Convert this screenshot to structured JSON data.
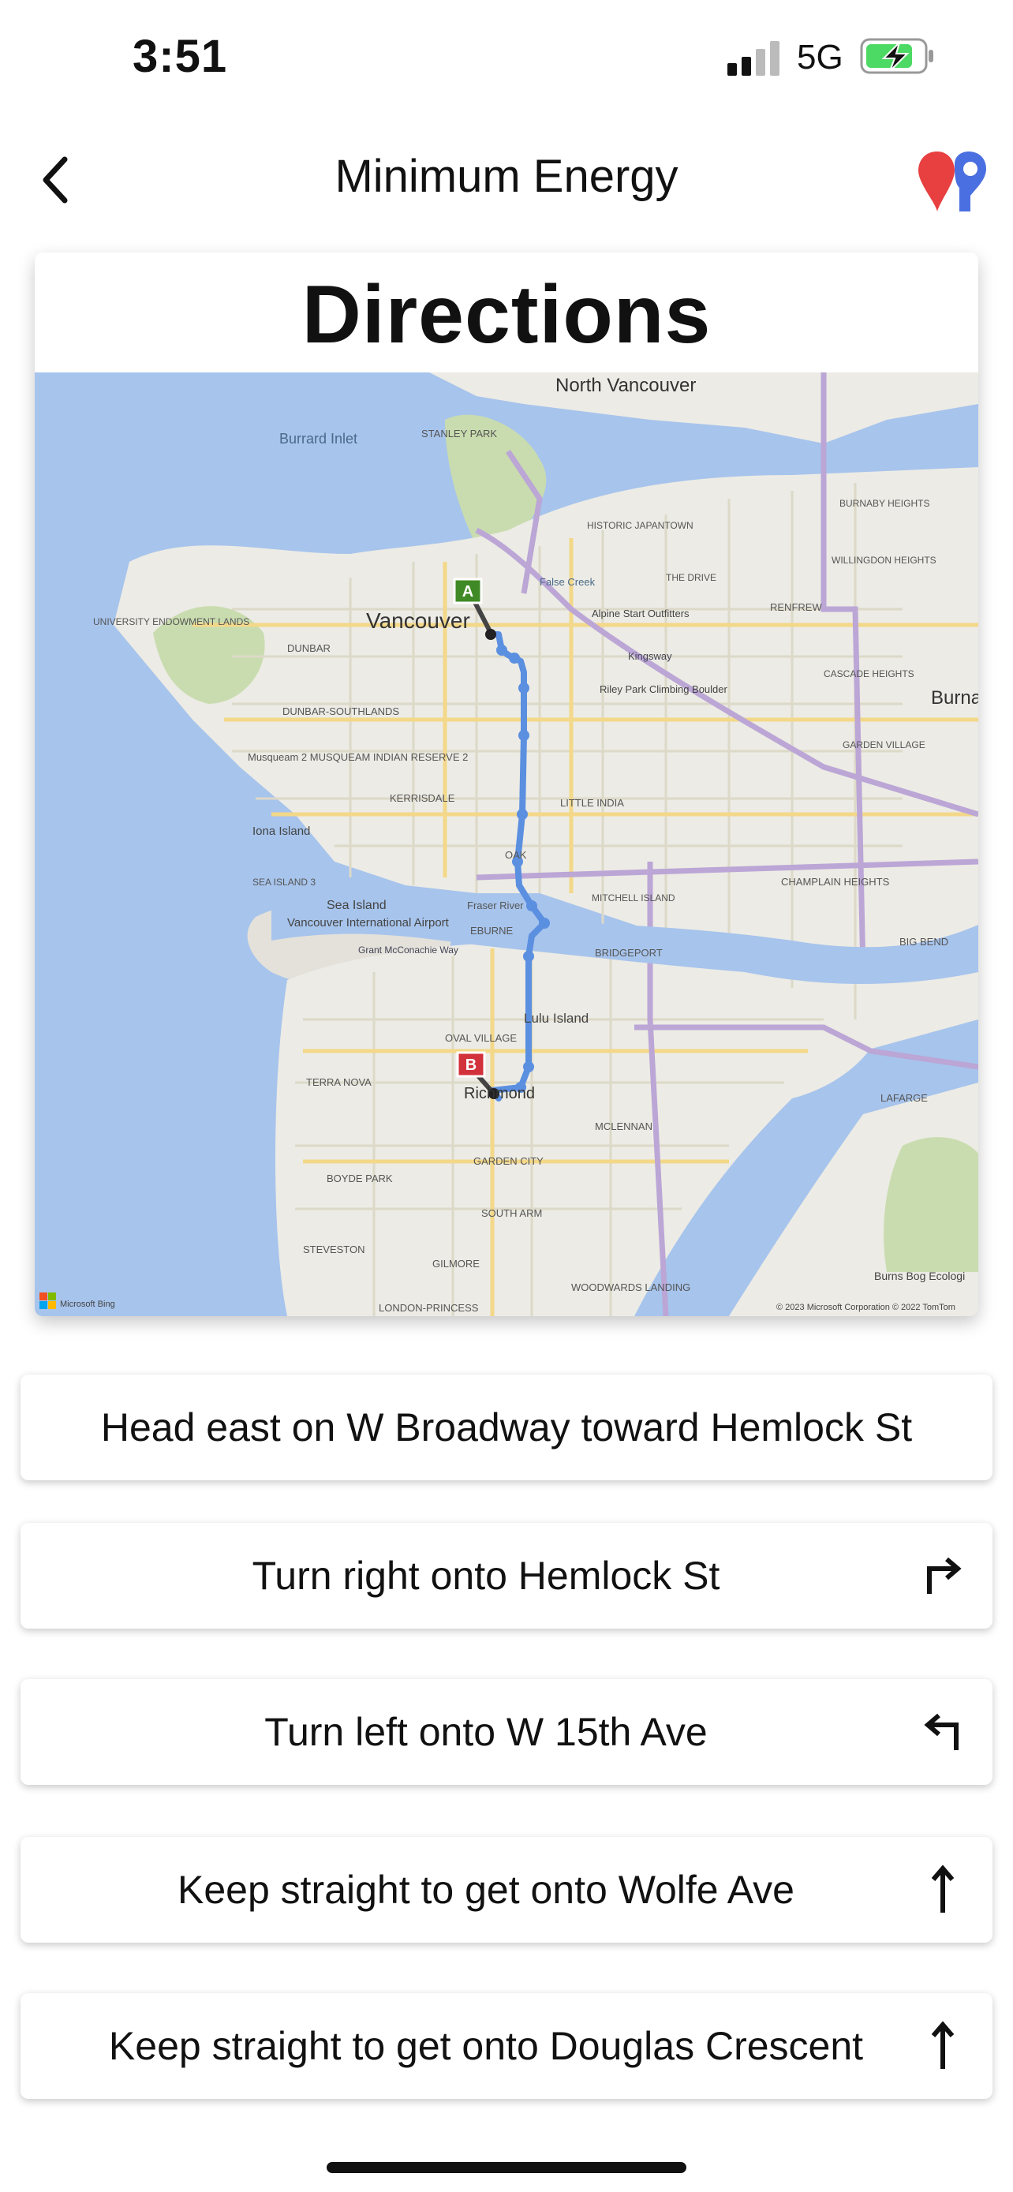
{
  "status_bar": {
    "time": "3:51",
    "network": "5G"
  },
  "nav": {
    "title": "Minimum Energy"
  },
  "card": {
    "title": "Directions"
  },
  "map": {
    "labels": {
      "north_vancouver": "North Vancouver",
      "burrard_inlet": "Burrard Inlet",
      "stanley_park": "STANLEY PARK",
      "vancouver": "Vancouver",
      "university": "UNIVERSITY ENDOWMENT LANDS",
      "dunbar": "DUNBAR",
      "dunbar_southlands": "DUNBAR-SOUTHLANDS",
      "kerrisdale": "KERRISDALE",
      "oak": "OAK",
      "musqueam": "Musqueam 2 MUSQUEAM INDIAN RESERVE 2",
      "iona": "Iona Island",
      "sea_island": "Sea Island",
      "airport": "Vancouver International Airport",
      "fraser_river": "Fraser River",
      "eburne": "EBURNE",
      "bridgeport": "BRIDGEPORT",
      "lulu": "Lulu Island",
      "richmond": "Richmond",
      "terra_nova": "TERRA NOVA",
      "oval_village": "OVAL VILLAGE",
      "mclennan": "MCLENNAN",
      "garden_city": "GARDEN CITY",
      "boyde_park": "BOYDE PARK",
      "south_arm": "SOUTH ARM",
      "steveston": "STEVESTON",
      "gilmore": "GILMORE",
      "woodwards": "WOODWARDS LANDING",
      "london_princess": "LONDON-PRINCESS",
      "burnaby": "Burna",
      "burnaby_heights": "BURNABY HEIGHTS",
      "willingdon": "WILLINGDON HEIGHTS",
      "renfrew": "RENFREW",
      "cascade": "CASCADE HEIGHTS",
      "garden_village": "GARDEN VILLAGE",
      "champlain": "CHAMPLAIN HEIGHTS",
      "big_bend": "BIG BEND",
      "lafarge": "LAFARGE",
      "burns_bog": "Burns Bog Ecologi",
      "little_india": "LITTLE INDIA",
      "mitchell": "MITCHELL ISLAND",
      "riley_park": "Riley Park Climbing Boulder",
      "historic_japantown": "HISTORIC JAPANTOWN",
      "the_drive": "THE DRIVE",
      "alpine": "Alpine Start Outfitters",
      "false_creek": "False Creek",
      "grant_mcconachie": "Grant McConachie Way",
      "kingsway": "Kingsway",
      "sea_island_3": "SEA ISLAND 3",
      "marker_a": "A",
      "marker_b": "B",
      "attribution": "© 2023 Microsoft Corporation © 2022 TomTom",
      "bing": "Microsoft Bing"
    },
    "colors": {
      "water": "#a7c4ec",
      "land": "#ecebe5",
      "route": "#5b8fe0",
      "park": "#c9dcaf",
      "major_road": "#bba6d6"
    }
  },
  "steps": [
    {
      "text": "Head east on W Broadway toward Hemlock St",
      "icon": "none"
    },
    {
      "text": "Turn right onto Hemlock St",
      "icon": "turn-right-icon"
    },
    {
      "text": "Turn left onto W 15th Ave",
      "icon": "turn-left-icon"
    },
    {
      "text": "Keep straight to get onto Wolfe Ave",
      "icon": "straight-arrow-icon"
    },
    {
      "text": "Keep straight to get onto Douglas Crescent",
      "icon": "straight-arrow-icon"
    }
  ]
}
